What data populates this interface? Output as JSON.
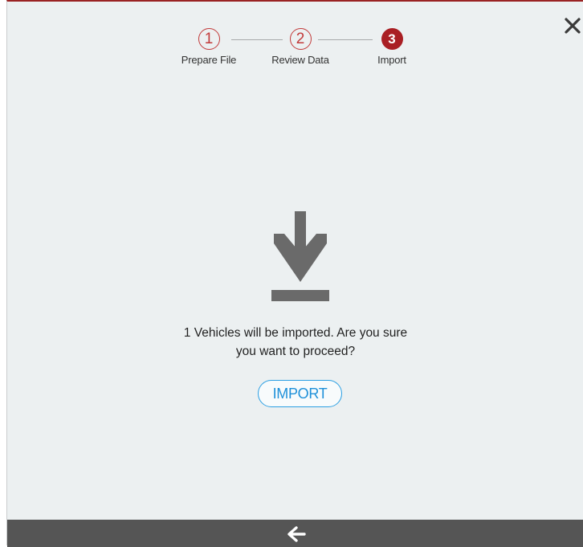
{
  "dialog": {
    "close_icon": "close-icon",
    "accent_color": "#a91f24"
  },
  "stepper": {
    "steps": [
      {
        "number": "1",
        "label": "Prepare File",
        "state": "done"
      },
      {
        "number": "2",
        "label": "Review Data",
        "state": "done"
      },
      {
        "number": "3",
        "label": "Import",
        "state": "active"
      }
    ]
  },
  "main": {
    "icon": "download-icon",
    "message_line1": "1 Vehicles will be imported. Are you sure",
    "message_line2": "you want to proceed?",
    "import_label": "IMPORT",
    "button_color": "#2b9fe3"
  },
  "footer": {
    "back_icon": "arrow-left-icon"
  }
}
